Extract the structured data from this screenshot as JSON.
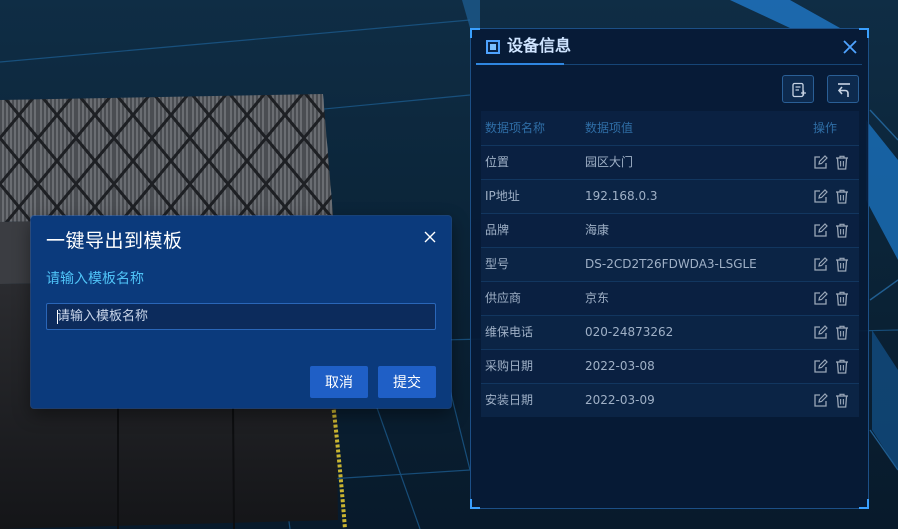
{
  "export_dialog": {
    "title": "一键导出到模板",
    "field_label": "请输入模板名称",
    "input_value": "",
    "input_placeholder": "请输入模板名称",
    "cancel_label": "取消",
    "submit_label": "提交",
    "close_icon": "close-icon",
    "accent_color": "#0b3a7c",
    "button_color": "#1f5fc6",
    "label_color": "#4fc3f7"
  },
  "device_panel": {
    "title": "设备信息",
    "header_icon": "device-icon",
    "close_icon": "close-icon",
    "toolbar": {
      "export_icon": "export-template-icon",
      "back_icon": "back-icon"
    },
    "columns": {
      "name": "数据项名称",
      "value": "数据项值",
      "operation": "操作"
    },
    "rows": [
      {
        "name": "位置",
        "value": "园区大门"
      },
      {
        "name": "IP地址",
        "value": "192.168.0.3"
      },
      {
        "name": "品牌",
        "value": "海康"
      },
      {
        "name": "型号",
        "value": "DS-2CD2T26FDWDA3-LSGLE"
      },
      {
        "name": "供应商",
        "value": "京东"
      },
      {
        "name": "维保电话",
        "value": "020-24873262"
      },
      {
        "name": "采购日期",
        "value": "2022-03-08"
      },
      {
        "name": "安装日期",
        "value": "2022-03-09"
      }
    ],
    "row_icons": [
      "edit-icon",
      "delete-icon"
    ],
    "border_color": "#1c4f86",
    "accent_color": "#3aa0ff"
  }
}
